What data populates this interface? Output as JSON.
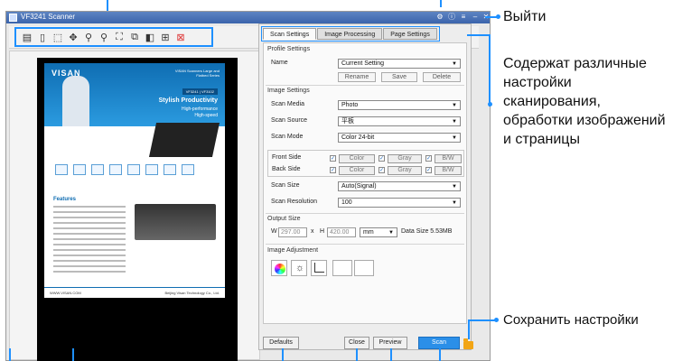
{
  "window": {
    "title": "VF3241 Scanner"
  },
  "preview_doc": {
    "brand": "VISAN",
    "tag": "VISAN Scanners Large and Flatbed Series",
    "badge": "VF3241 | VF3102",
    "title": "Stylish Productivity",
    "sub1": "High-performance",
    "sub2": "High-speed",
    "features": "Features",
    "footer_left": "WWW.VISAN.COM",
    "footer_mid": "Beijing Visan Technology Co., Ltd."
  },
  "tabs": [
    "Scan Settings",
    "Image Processing",
    "Page Settings"
  ],
  "profile": {
    "title": "Profile Settings",
    "name_label": "Name",
    "name_value": "Current Setting",
    "rename": "Rename",
    "save": "Save",
    "delete": "Delete"
  },
  "image": {
    "title": "Image Settings",
    "media_label": "Scan Media",
    "media_value": "Photo",
    "source_label": "Scan Source",
    "source_value": "平板",
    "mode_label": "Scan Mode",
    "mode_value": "Color 24-bit",
    "front_label": "Front Side",
    "back_label": "Back Side",
    "color": "Color",
    "gray": "Gray",
    "bw": "B/W",
    "size_label": "Scan Size",
    "size_value": "Auto(Signal)",
    "res_label": "Scan Resolution",
    "res_value": "100"
  },
  "output": {
    "title": "Output Size",
    "w_label": "W",
    "w_value": "297.00",
    "x_label": "x",
    "h_label": "H",
    "h_value": "420.00",
    "unit": "mm",
    "data_size": "Data Size 5.53MB"
  },
  "adjust": {
    "title": "Image Adjustment"
  },
  "footer": {
    "defaults": "Defaults",
    "close": "Close",
    "preview": "Preview",
    "scan": "Scan"
  },
  "annotations": {
    "exit": "Выйти",
    "settings_desc": "Содержат различные настройки сканирования, обработки изображений и страницы",
    "save_settings": "Сохранить настройки"
  },
  "colors": {
    "accent": "#1e90ff",
    "scan_button": "#2b8fe8",
    "folder": "#f2a515"
  }
}
